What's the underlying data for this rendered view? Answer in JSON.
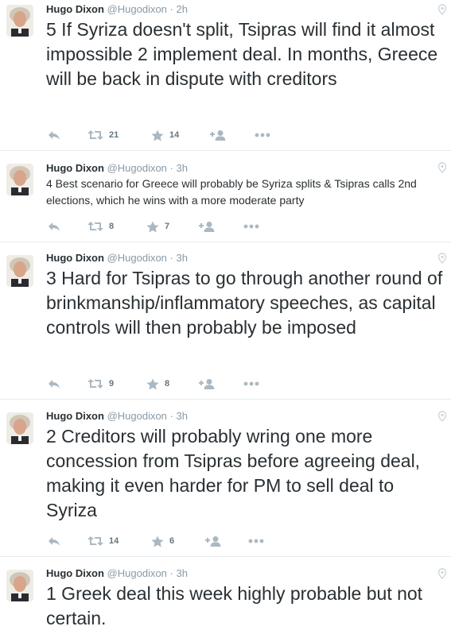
{
  "tweets": [
    {
      "name": "Hugo Dixon",
      "handle": "@Hugodixon",
      "time": "2h",
      "text": "5 If Syriza doesn't split, Tsipras will find it almost impossible 2 implement deal. In months, Greece will be back in dispute with creditors",
      "retweets": "21",
      "favorites": "14"
    },
    {
      "name": "Hugo Dixon",
      "handle": "@Hugodixon",
      "time": "3h",
      "text": "4 Best scenario for Greece will probably be Syriza splits & Tsipras calls 2nd elections, which he wins with a more moderate party",
      "retweets": "8",
      "favorites": "7"
    },
    {
      "name": "Hugo Dixon",
      "handle": "@Hugodixon",
      "time": "3h",
      "text": "3 Hard for Tsipras to go through another round of brinkmanship/inflammatory speeches, as capital controls will then probably be imposed",
      "retweets": "9",
      "favorites": "8"
    },
    {
      "name": "Hugo Dixon",
      "handle": "@Hugodixon",
      "time": "3h",
      "text": "2 Creditors will probably wring one more concession from Tsipras before agreeing deal, making it even harder for PM to sell deal to Syriza",
      "retweets": "14",
      "favorites": "6"
    },
    {
      "name": "Hugo Dixon",
      "handle": "@Hugodixon",
      "time": "3h",
      "text": "1 Greek deal this week highly probable but not certain."
    }
  ],
  "separator": "·",
  "icons": {
    "reply": "reply-icon",
    "retweet": "retweet-icon",
    "favorite": "star-icon",
    "follow": "follow-icon",
    "more": "more-icon",
    "location": "location-pin-icon"
  },
  "colors": {
    "icon": "#aab8c2",
    "meta": "#8899a6",
    "text": "#292f33",
    "divider": "#e6ecf0"
  }
}
